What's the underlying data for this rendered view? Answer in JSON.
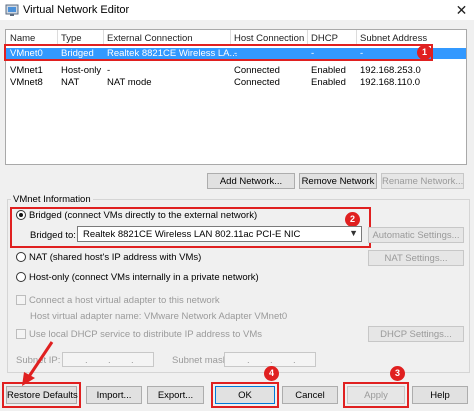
{
  "window": {
    "title": "Virtual Network Editor",
    "close_glyph": "✕",
    "app_icon": "vmware-network-icon"
  },
  "network_list": {
    "columns": [
      "Name",
      "Type",
      "External Connection",
      "Host Connection",
      "DHCP",
      "Subnet Address"
    ],
    "rows": [
      [
        "VMnet0",
        "Bridged",
        "Realtek 8821CE Wireless LA...",
        "-",
        "-",
        "-"
      ],
      [
        "VMnet1",
        "Host-only",
        "-",
        "Connected",
        "Enabled",
        "192.168.253.0"
      ],
      [
        "VMnet8",
        "NAT",
        "NAT mode",
        "Connected",
        "Enabled",
        "192.168.110.0"
      ]
    ],
    "selected_index": 0
  },
  "list_buttons": {
    "add": "Add Network...",
    "remove": "Remove Network",
    "rename": "Rename Network..."
  },
  "vmnet_info": {
    "group_title": "VMnet Information",
    "bridged_label": "Bridged (connect VMs directly to the external network)",
    "bridged_to_label": "Bridged to:",
    "bridged_to_value": "Realtek 8821CE Wireless LAN 802.11ac PCI-E NIC",
    "automatic_settings": "Automatic Settings...",
    "nat_label": "NAT (shared host's IP address with VMs)",
    "nat_settings": "NAT Settings...",
    "hostonly_label": "Host-only (connect VMs internally in a private network)",
    "connect_adapter_label": "Connect a host virtual adapter to this network",
    "adapter_name_text": "Host virtual adapter name: VMware Network Adapter VMnet0",
    "dhcp_label": "Use local DHCP service to distribute IP address to VMs",
    "dhcp_settings": "DHCP Settings...",
    "subnet_ip_label": "Subnet IP:",
    "subnet_mask_label": "Subnet mask:",
    "ip_dot": "."
  },
  "footer": {
    "restore_defaults": "Restore Defaults",
    "import": "Import...",
    "export": "Export...",
    "ok": "OK",
    "cancel": "Cancel",
    "apply": "Apply",
    "help": "Help"
  },
  "annotations": {
    "badges": [
      "1",
      "2",
      "3",
      "4"
    ],
    "highlight_color": "#e02020"
  }
}
